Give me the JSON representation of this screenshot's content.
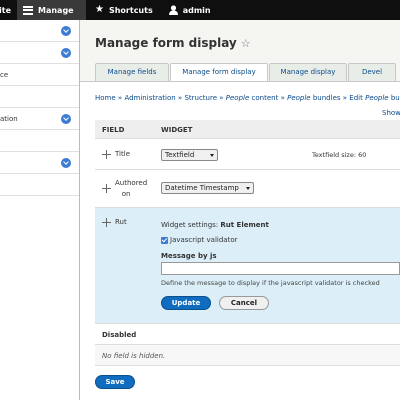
{
  "toolbar": {
    "site_label": "ite",
    "manage_label": "Manage",
    "shortcuts_label": "Shortcuts",
    "user_label": "admin"
  },
  "sidebar": {
    "items": [
      {
        "label": "",
        "has_chevron": true
      },
      {
        "label": "",
        "has_chevron": true
      },
      {
        "label": "ce",
        "has_chevron": false
      },
      {
        "label": "",
        "has_chevron": false
      },
      {
        "label": "ation",
        "has_chevron": true
      },
      {
        "label": "",
        "has_chevron": false
      },
      {
        "label": "",
        "has_chevron": true
      },
      {
        "label": "",
        "has_chevron": false
      }
    ]
  },
  "page": {
    "title": "Manage form display",
    "tabs": [
      {
        "label": "Manage fields",
        "active": false
      },
      {
        "label": "Manage form display",
        "active": true
      },
      {
        "label": "Manage display",
        "active": false
      },
      {
        "label": "Devel",
        "active": false
      }
    ],
    "breadcrumb": {
      "home": "Home",
      "administration": "Administration",
      "structure": "Structure",
      "people_content_em": "People",
      "people_content_rest": "content",
      "people_bundles_em": "People",
      "people_bundles_rest": "bundles",
      "edit_prefix": "Edit",
      "edit_em": "People",
      "edit_rest": "bundle",
      "separator": "»"
    },
    "show_link": "Show"
  },
  "table": {
    "headers": {
      "field": "FIELD",
      "widget": "WIDGET"
    },
    "rows": [
      {
        "label": "Title",
        "widget": "Textfield",
        "summary": "Textfield size: 60"
      },
      {
        "label_line1": "Authored",
        "label_line2": "on",
        "widget": "Datetime Timestamp"
      }
    ],
    "rut": {
      "label": "Rut",
      "widget_settings_prefix": "Widget settings:",
      "widget_settings_name": "Rut Element",
      "checkbox_label": "Javascript validator",
      "checkbox_checked": true,
      "message_label": "Message by js",
      "message_value": "",
      "message_desc": "Define the message to display if the javascript validator is checked",
      "update_label": "Update",
      "cancel_label": "Cancel"
    },
    "disabled_label": "Disabled",
    "no_field_hidden": "No field is hidden."
  },
  "save_label": "Save",
  "colors": {
    "toolbar_bg": "#0f0f0f",
    "accent": "#0f6cbf",
    "link": "#0a4b8a",
    "highlight_row": "#dceef8"
  }
}
